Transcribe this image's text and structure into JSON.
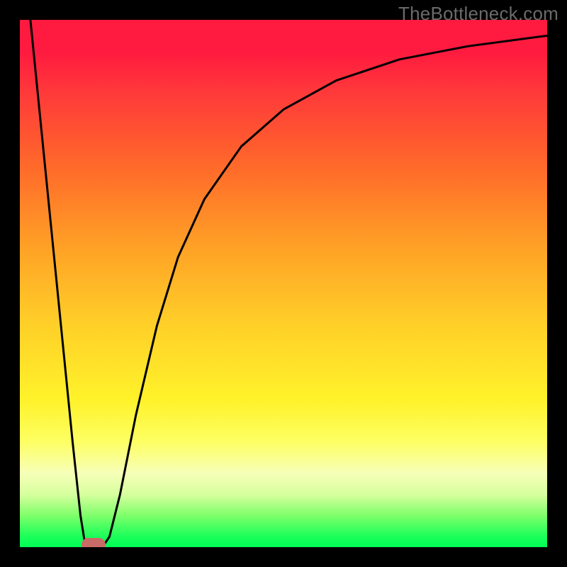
{
  "watermark": "TheBottleneck.com",
  "chart_data": {
    "type": "line",
    "title": "",
    "xlabel": "",
    "ylabel": "",
    "xlim": [
      0,
      100
    ],
    "ylim": [
      0,
      100
    ],
    "grid": false,
    "legend": false,
    "curve_points": [
      {
        "x": 2.0,
        "y": 100.0
      },
      {
        "x": 3.0,
        "y": 90.0
      },
      {
        "x": 5.0,
        "y": 70.0
      },
      {
        "x": 7.5,
        "y": 45.0
      },
      {
        "x": 10.0,
        "y": 20.0
      },
      {
        "x": 11.5,
        "y": 6.0
      },
      {
        "x": 12.3,
        "y": 1.0
      },
      {
        "x": 13.0,
        "y": 0.0
      },
      {
        "x": 15.0,
        "y": 0.0
      },
      {
        "x": 16.0,
        "y": 0.5
      },
      {
        "x": 17.0,
        "y": 2.0
      },
      {
        "x": 19.0,
        "y": 10.0
      },
      {
        "x": 22.0,
        "y": 25.0
      },
      {
        "x": 26.0,
        "y": 42.0
      },
      {
        "x": 30.0,
        "y": 55.0
      },
      {
        "x": 35.0,
        "y": 66.0
      },
      {
        "x": 42.0,
        "y": 76.0
      },
      {
        "x": 50.0,
        "y": 83.0
      },
      {
        "x": 60.0,
        "y": 88.5
      },
      {
        "x": 72.0,
        "y": 92.5
      },
      {
        "x": 85.0,
        "y": 95.0
      },
      {
        "x": 100.0,
        "y": 97.0
      }
    ],
    "marker": {
      "shape": "rounded-rect",
      "color": "#c96b66",
      "x_center": 14.0,
      "y_center": 0.5,
      "width_pct": 4.5,
      "height_pct": 2.6
    },
    "background_gradient_stops": [
      {
        "pos": 0,
        "color": "#ff1a3f"
      },
      {
        "pos": 6,
        "color": "#ff1a3f"
      },
      {
        "pos": 14,
        "color": "#ff3a3a"
      },
      {
        "pos": 28,
        "color": "#ff6a2a"
      },
      {
        "pos": 44,
        "color": "#ffa426"
      },
      {
        "pos": 58,
        "color": "#ffd028"
      },
      {
        "pos": 72,
        "color": "#fff22a"
      },
      {
        "pos": 80,
        "color": "#fdff63"
      },
      {
        "pos": 86,
        "color": "#f6ffb8"
      },
      {
        "pos": 90,
        "color": "#d7ff9e"
      },
      {
        "pos": 94,
        "color": "#7eff6a"
      },
      {
        "pos": 98,
        "color": "#1aff5a"
      },
      {
        "pos": 100,
        "color": "#00ff55"
      }
    ]
  }
}
